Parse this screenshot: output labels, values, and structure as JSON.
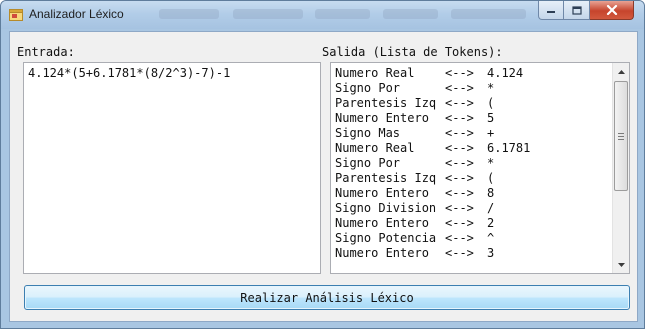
{
  "window": {
    "title": "Analizador Léxico",
    "icon": "form-icon"
  },
  "labels": {
    "input": "Entrada:",
    "output": "Salida (Lista de Tokens):"
  },
  "input": {
    "value": "4.124*(5+6.1781*(8/2^3)-7)-1"
  },
  "tokens": [
    {
      "name": "Numero Real",
      "arrow": "<-->",
      "value": "4.124"
    },
    {
      "name": "Signo Por",
      "arrow": "<-->",
      "value": "*"
    },
    {
      "name": "Parentesis Izq",
      "arrow": "<-->",
      "value": "("
    },
    {
      "name": "Numero Entero",
      "arrow": "<-->",
      "value": "5"
    },
    {
      "name": "Signo Mas",
      "arrow": "<-->",
      "value": "+"
    },
    {
      "name": "Numero Real",
      "arrow": "<-->",
      "value": "6.1781"
    },
    {
      "name": "Signo Por",
      "arrow": "<-->",
      "value": "*"
    },
    {
      "name": "Parentesis Izq",
      "arrow": "<-->",
      "value": "("
    },
    {
      "name": "Numero Entero",
      "arrow": "<-->",
      "value": "8"
    },
    {
      "name": "Signo Division",
      "arrow": "<-->",
      "value": "/"
    },
    {
      "name": "Numero Entero",
      "arrow": "<-->",
      "value": "2"
    },
    {
      "name": "Signo Potencia",
      "arrow": "<-->",
      "value": "^"
    },
    {
      "name": "Numero Entero",
      "arrow": "<-->",
      "value": "3"
    }
  ],
  "button": {
    "label": "Realizar Análisis Léxico"
  },
  "colors": {
    "title_bar": "#b2cde8",
    "close_button": "#c6452d",
    "button_border": "#3c7fb1"
  }
}
